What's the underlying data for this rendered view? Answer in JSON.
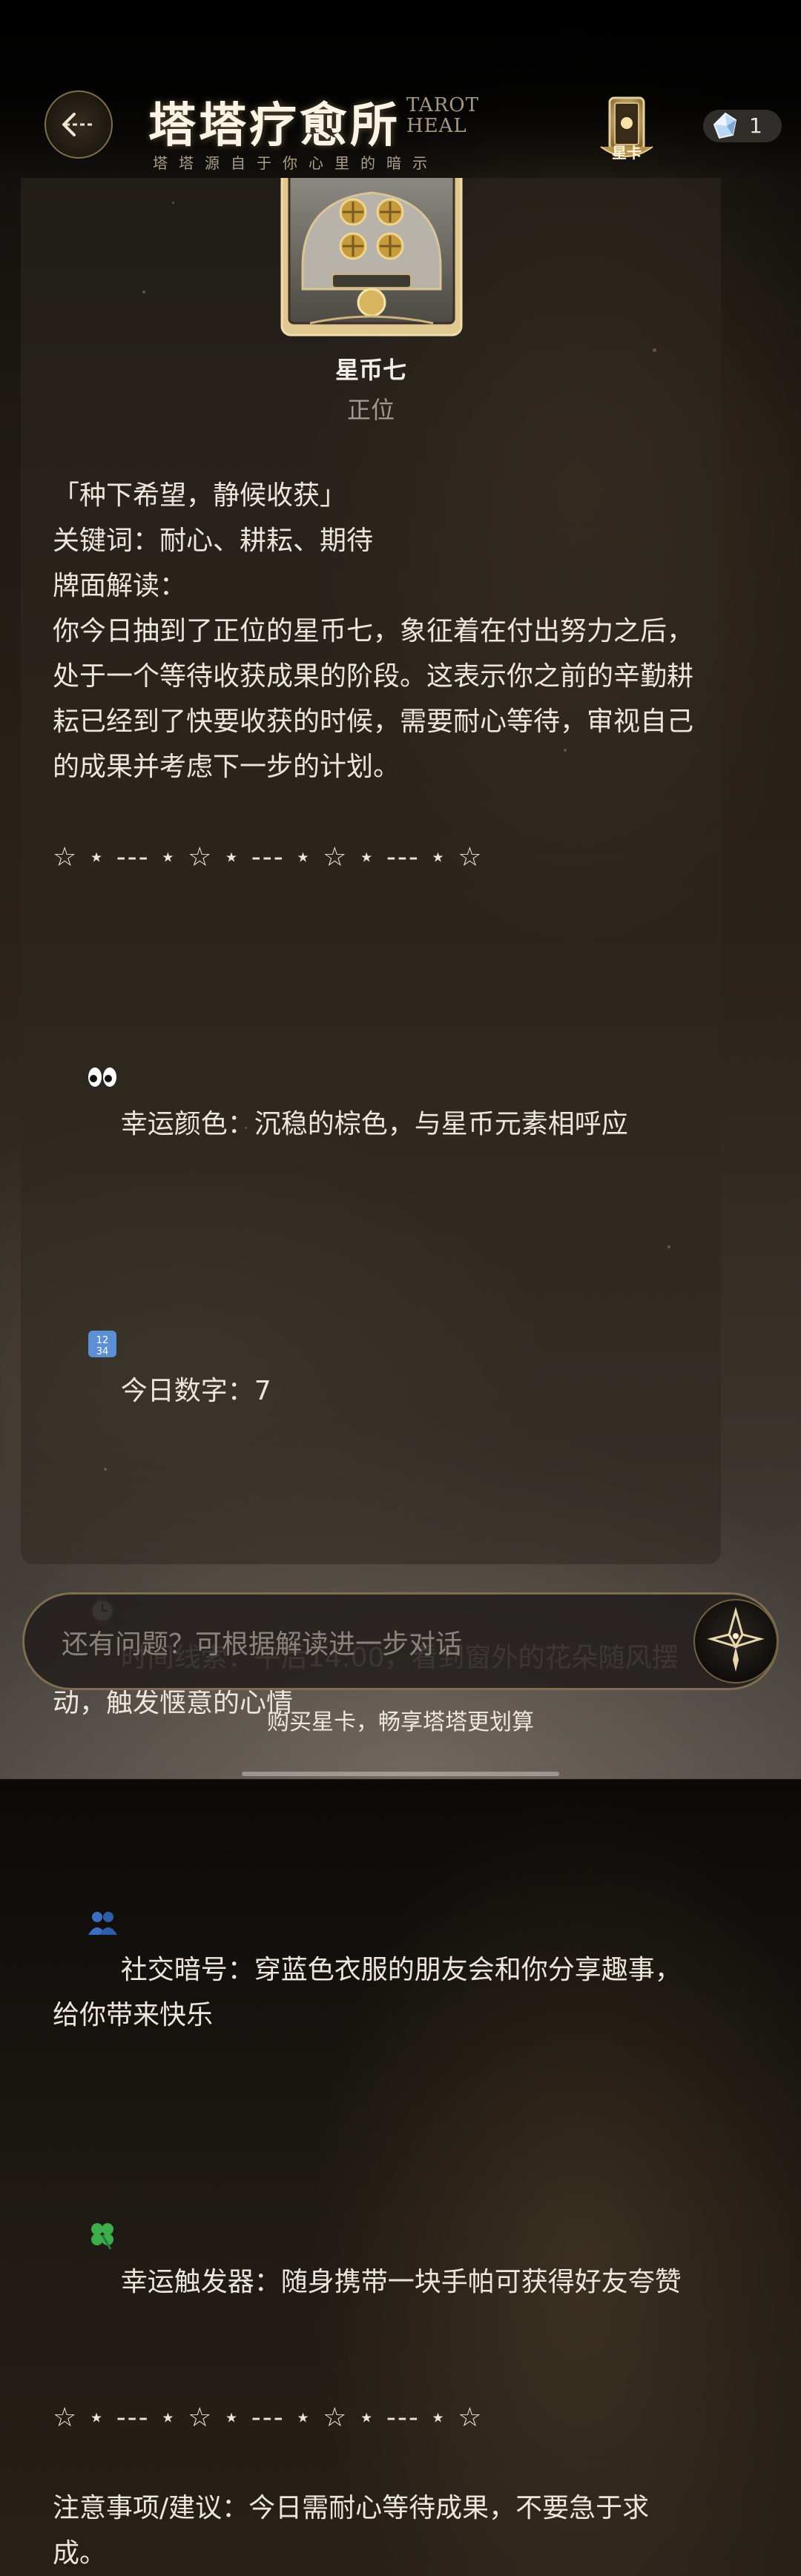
{
  "header": {
    "back_icon": "back-arrow-icon",
    "title": "塔塔疗愈所",
    "brand_en": "TAROT HEAL",
    "subtitle": "塔塔源自于你心里的暗示",
    "star_card_label": "星卡",
    "gem_icon": "crystal-gem-icon",
    "gem_count": "1"
  },
  "card": {
    "name": "星币七",
    "orientation": "正位"
  },
  "reading": {
    "motto": "「种下希望，静候收获」",
    "keywords": "关键词：耐心、耕耘、期待",
    "interpretation_label": "牌面解读：",
    "interpretation": "你今日抽到了正位的星币七，象征着在付出努力之后，处于一个等待收获成果的阶段。这表示你之前的辛勤耕耘已经到了快要收获的时候，需要耐心等待，审视自己的成果并考虑下一步的计划。",
    "divider": "☆ ⋆ --- ⋆ ☆ ⋆ --- ⋆ ☆ ⋆ --- ⋆ ☆",
    "lucky_color": "幸运颜色：沉稳的棕色，与星币元素相呼应",
    "lucky_number": "今日数字：7",
    "time_clue": "时间线索：午后14:00，看到窗外的花朵随风摆动，触发惬意的心情",
    "social_code": "社交暗号：穿蓝色衣服的朋友会和你分享趣事，给你带来快乐",
    "lucky_trigger": "幸运触发器：随身携带一块手帕可获得好友夸赞",
    "advice": "注意事项/建议：今日需耐心等待成果，不要急于求成。"
  },
  "icons": {
    "eyes": "eyes-emoji-icon",
    "numbers": "numbers-emoji-icon",
    "watch": "watch-emoji-icon",
    "people": "people-emoji-icon",
    "clover": "four-leaf-clover-icon",
    "send": "star-send-icon"
  },
  "input": {
    "placeholder": "还有问题？可根据解读进一步对话"
  },
  "footer": {
    "promo": "购买星卡，畅享塔塔更划算"
  },
  "colors": {
    "accent_gold": "#c9a86a",
    "text": "#ece6dc",
    "muted": "#a09a92"
  }
}
